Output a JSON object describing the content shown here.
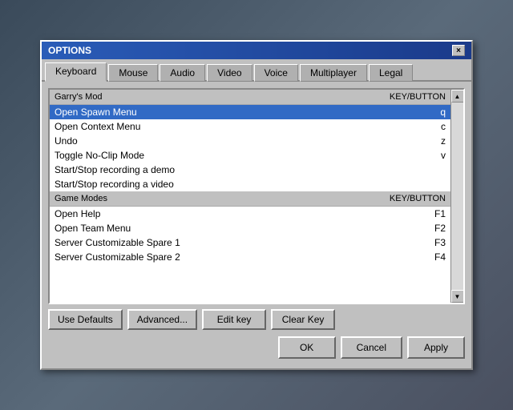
{
  "dialog": {
    "title": "OPTIONS",
    "close_label": "×"
  },
  "tabs": [
    {
      "id": "keyboard",
      "label": "Keyboard",
      "active": true
    },
    {
      "id": "mouse",
      "label": "Mouse",
      "active": false
    },
    {
      "id": "audio",
      "label": "Audio",
      "active": false
    },
    {
      "id": "video",
      "label": "Video",
      "active": false
    },
    {
      "id": "voice",
      "label": "Voice",
      "active": false
    },
    {
      "id": "multiplayer",
      "label": "Multiplayer",
      "active": false
    },
    {
      "id": "legal",
      "label": "Legal",
      "active": false
    }
  ],
  "sections": [
    {
      "id": "garrys-mod",
      "label": "Garry's Mod",
      "key_header": "KEY/BUTTON",
      "rows": [
        {
          "action": "Open Spawn Menu",
          "key": "q",
          "selected": true
        },
        {
          "action": "Open Context Menu",
          "key": "c",
          "selected": false
        },
        {
          "action": "Undo",
          "key": "z",
          "selected": false
        },
        {
          "action": "Toggle No-Clip Mode",
          "key": "v",
          "selected": false
        },
        {
          "action": "Start/Stop recording a demo",
          "key": "",
          "selected": false
        },
        {
          "action": "Start/Stop recording a video",
          "key": "",
          "selected": false
        }
      ]
    },
    {
      "id": "game-modes",
      "label": "Game Modes",
      "key_header": "KEY/BUTTON",
      "rows": [
        {
          "action": "Open Help",
          "key": "F1",
          "selected": false
        },
        {
          "action": "Open Team Menu",
          "key": "F2",
          "selected": false
        },
        {
          "action": "Server Customizable Spare 1",
          "key": "F3",
          "selected": false
        },
        {
          "action": "Server Customizable Spare 2",
          "key": "F4",
          "selected": false
        }
      ]
    }
  ],
  "bottom_buttons": {
    "use_defaults": "Use Defaults",
    "advanced": "Advanced...",
    "edit_key": "Edit key",
    "clear_key": "Clear Key"
  },
  "action_buttons": {
    "ok": "OK",
    "cancel": "Cancel",
    "apply": "Apply"
  }
}
